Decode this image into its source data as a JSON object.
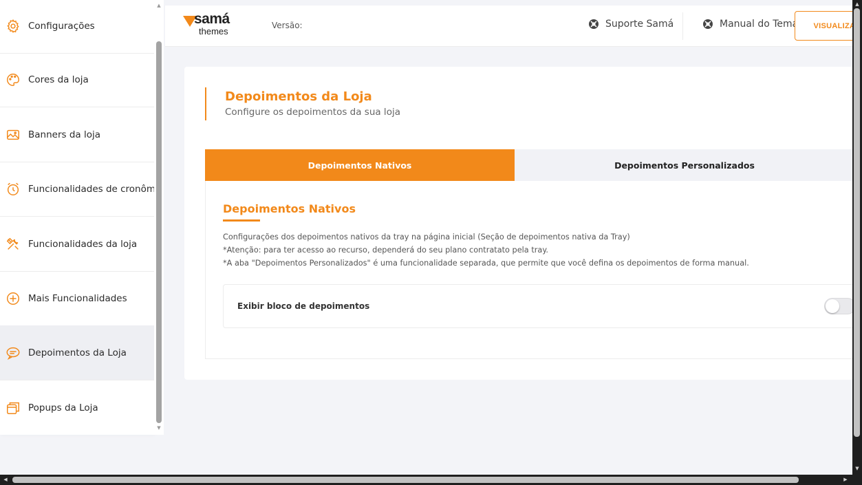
{
  "colors": {
    "accent": "#f2891a",
    "active_item_bg": "#eeeff3",
    "tab_inactive_bg": "#f1f2f6"
  },
  "sidebar": {
    "items": [
      {
        "label": "Configurações",
        "icon": "gear-icon"
      },
      {
        "label": "Cores da loja",
        "icon": "palette-icon"
      },
      {
        "label": "Banners da loja",
        "icon": "image-icon"
      },
      {
        "label": "Funcionalidades de cronômetro",
        "icon": "alarm-clock-icon"
      },
      {
        "label": "Funcionalidades da loja",
        "icon": "tools-icon"
      },
      {
        "label": "Mais Funcionalidades",
        "icon": "plus-circle-icon"
      },
      {
        "label": "Depoimentos da Loja",
        "icon": "chat-bubble-icon",
        "active": true
      },
      {
        "label": "Popups da Loja",
        "icon": "popup-window-icon"
      }
    ]
  },
  "header": {
    "logo_line1": "samá",
    "logo_line2": "themes",
    "version_label": "Versão:",
    "support_link": "Suporte Samá",
    "manual_link": "Manual do Tema",
    "view_button": "VISUALIZAR"
  },
  "main": {
    "title": "Depoimentos da Loja",
    "subtitle": "Configure os depoimentos da sua loja",
    "tabs": [
      {
        "label": "Depoimentos Nativos",
        "active": true
      },
      {
        "label": "Depoimentos Personalizados",
        "active": false
      }
    ],
    "section_title": "Depoimentos Nativos",
    "description": [
      "Configurações dos depoimentos nativos da tray na página inicial (Seção de depoimentos nativa da Tray)",
      "*Atenção: para ter acesso ao recurso, dependerá do seu plano contratato pela tray.",
      "*A aba \"Depoimentos Personalizados\" é uma funcionalidade separada, que permite que você defina os depoimentos de forma manual."
    ],
    "option": {
      "label": "Exibir bloco de depoimentos",
      "enabled": false
    }
  }
}
